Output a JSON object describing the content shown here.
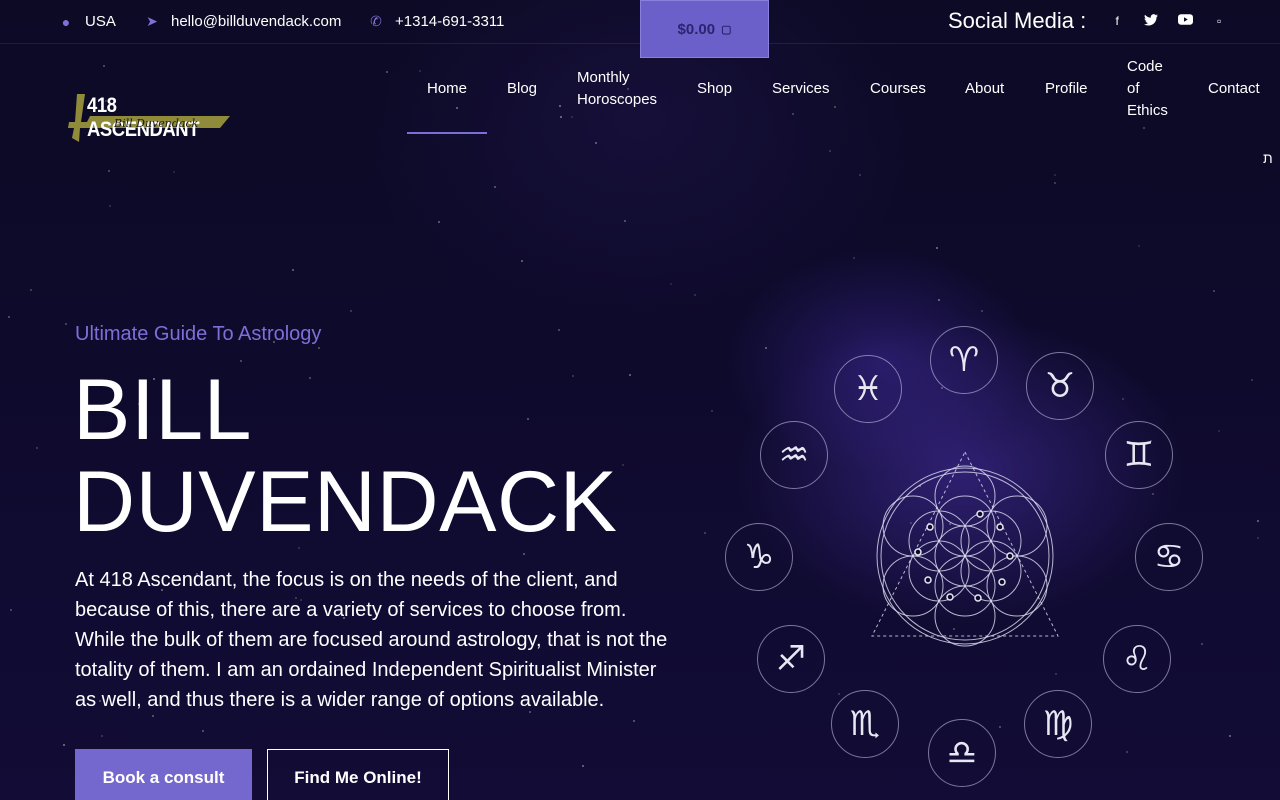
{
  "topbar": {
    "location": "USA",
    "email": "hello@billduvendack.com",
    "phone": "+1314-691-3311",
    "cart": "$0.00",
    "social_label": "Social Media :",
    "social_icons": [
      "facebook-icon",
      "twitter-icon",
      "youtube-icon",
      "instagram-icon"
    ]
  },
  "logo": {
    "main": "418 ASCENDANT",
    "sub": "Bill Duvendack"
  },
  "nav": {
    "items": [
      "Home",
      "Blog",
      "Monthly Horoscopes",
      "Shop",
      "Services",
      "Courses",
      "About",
      "Profile",
      "Code of Ethics",
      "Contact"
    ],
    "active": "Home",
    "accent": "#7a6fd6"
  },
  "hero": {
    "subtitle": "Ultimate Guide To Astrology",
    "title_line1": "BILL",
    "title_line2": "DUVENDACK",
    "description": "At 418 Ascendant, the focus is on the needs of the client, and because of this, there are a variety of services to choose from. While the bulk of them are focused around astrology, that is not the totality of them. I am an ordained Independent Spiritualist Minister as well, and thus there is a wider range of options available.",
    "btn_primary": "Book a consult",
    "btn_secondary": "Find Me Online!"
  },
  "zodiac": {
    "signs": [
      "♈",
      "♉",
      "♊",
      "♋",
      "♌",
      "♍",
      "♎",
      "♏",
      "♐",
      "♑",
      "♒",
      "♓"
    ]
  },
  "colors": {
    "accent": "#7468cf",
    "background": "#0c0a25",
    "subtitle": "#7c70d8"
  }
}
